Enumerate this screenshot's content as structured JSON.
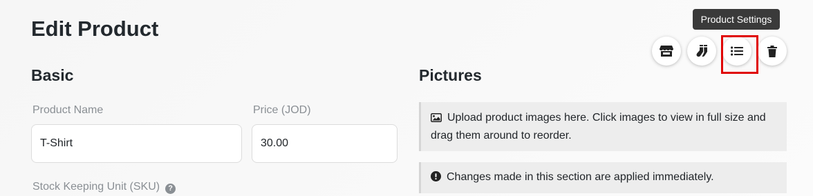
{
  "page": {
    "title": "Edit Product"
  },
  "toolbar": {
    "tooltip": "Product Settings",
    "buttons": [
      {
        "icon": "store-icon"
      },
      {
        "icon": "socks-icon"
      },
      {
        "icon": "list-icon"
      },
      {
        "icon": "trash-icon"
      }
    ]
  },
  "basic": {
    "title": "Basic",
    "product_name_label": "Product Name",
    "product_name_value": "T-Shirt",
    "price_label": "Price (JOD)",
    "price_value": "30.00",
    "sku_label": "Stock Keeping Unit (SKU)",
    "sku_help_glyph": "?"
  },
  "pictures": {
    "title": "Pictures",
    "info_text": "Upload product images here. Click images to view in full size and drag them around to reorder.",
    "warning_text": "Changes made in this section are applied immediately."
  },
  "colors": {
    "highlight": "#e00000",
    "tooltip_bg": "#3a3a3a"
  }
}
